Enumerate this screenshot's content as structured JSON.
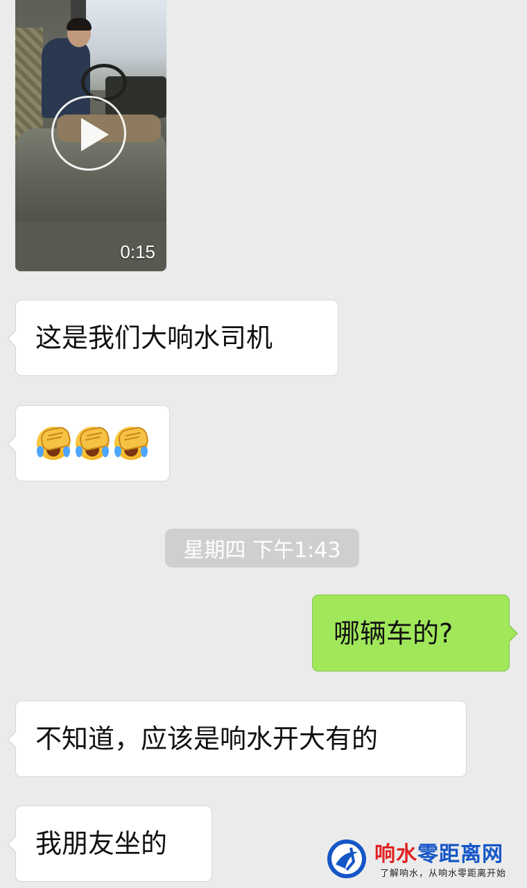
{
  "video": {
    "duration": "0:15"
  },
  "messages": [
    {
      "side": "left",
      "text": "这是我们大响水司机"
    },
    {
      "side": "left",
      "emoji": [
        "facepalm-crying-emoji",
        "facepalm-crying-emoji",
        "facepalm-crying-emoji"
      ]
    },
    {
      "side": "right",
      "text": "哪辆车的?"
    },
    {
      "side": "left",
      "text": "不知道，应该是响水开大有的"
    },
    {
      "side": "left",
      "text": "我朋友坐的"
    }
  ],
  "timestamp": "星期四 下午1:43",
  "watermark": {
    "title_red": "响水",
    "title_blue": "零距离网",
    "subtitle": "了解响水，从响水零距离开始"
  },
  "colors": {
    "background": "#ebebeb",
    "incoming_bubble": "#ffffff",
    "outgoing_bubble": "#a0e75a",
    "timestamp_bg": "#cfcfcf",
    "brand_red": "#e02424",
    "brand_blue": "#1556c7"
  }
}
